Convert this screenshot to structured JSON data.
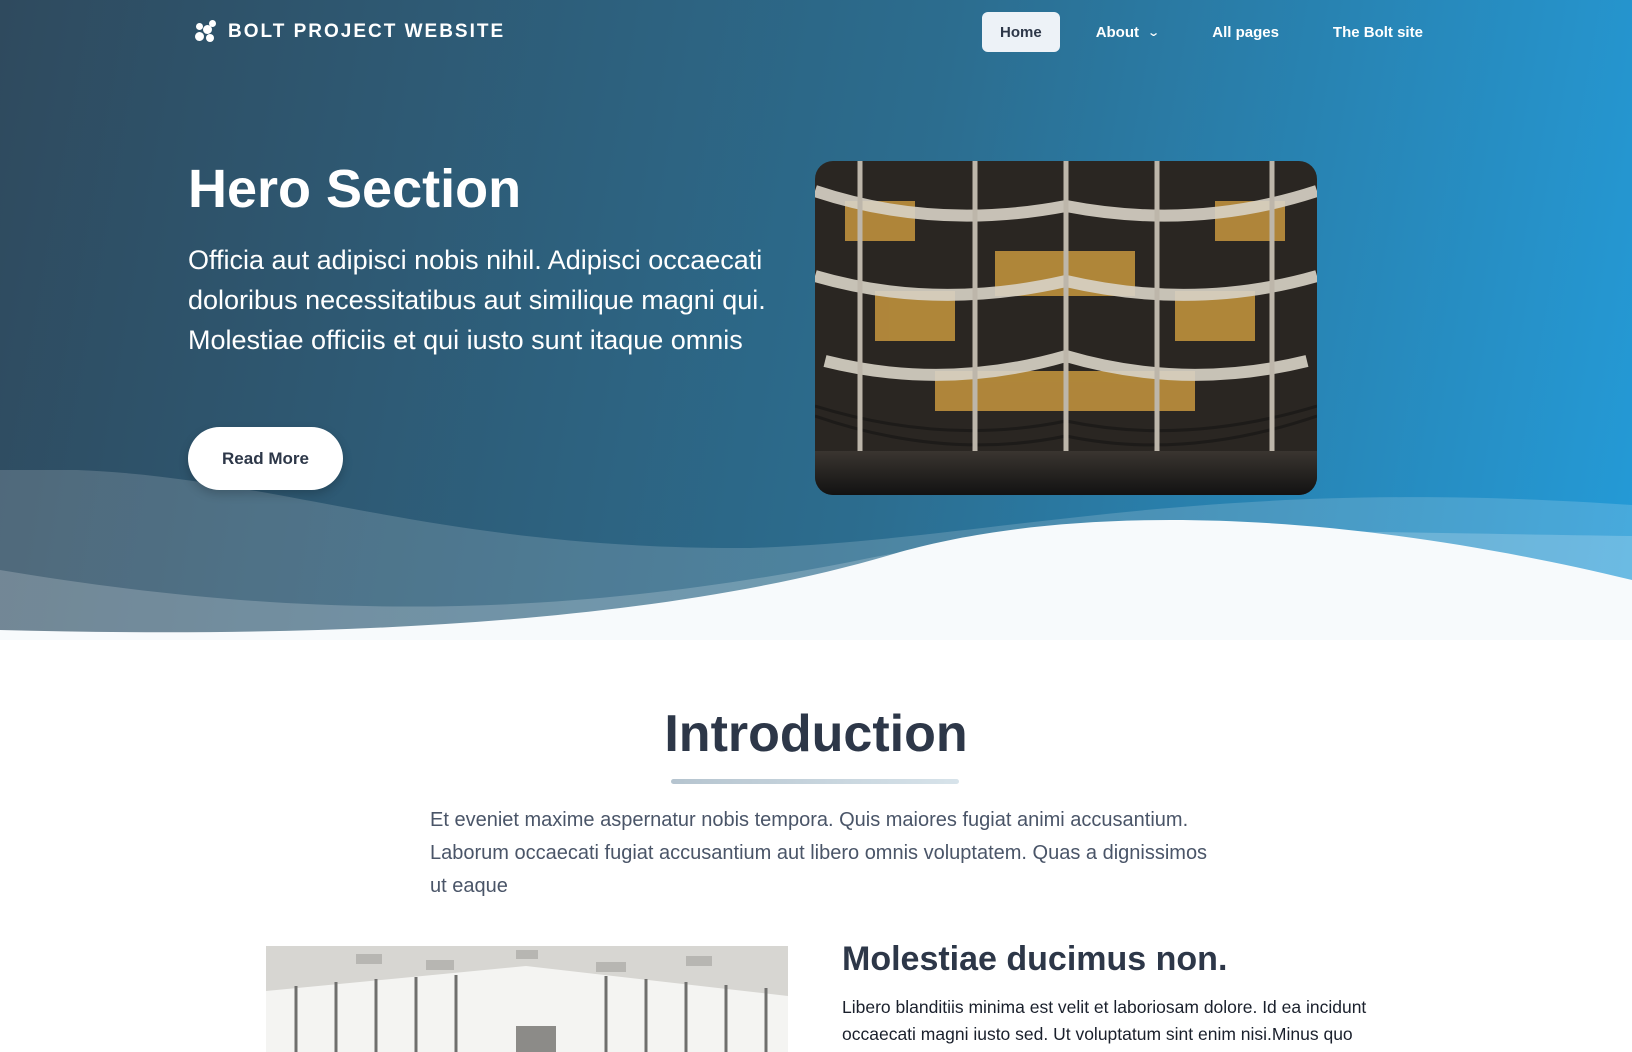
{
  "navbar": {
    "brand": "BOLT PROJECT WEBSITE",
    "items": [
      {
        "label": "Home",
        "active": true
      },
      {
        "label": "About",
        "dropdown": true
      },
      {
        "label": "All pages"
      },
      {
        "label": "The Bolt site"
      }
    ]
  },
  "hero": {
    "title": "Hero Section",
    "text": "Officia aut adipisci nobis nihil. Adipisci occaecati doloribus necessitatibus aut similique magni qui. Molestiae officiis et qui iusto sunt itaque omnis",
    "button": "Read More"
  },
  "intro": {
    "title": "Introduction",
    "text": "Et eveniet maxime aspernatur nobis tempora. Quis maiores fugiat animi accusantium. Laborum occaecati fugiat accusantium aut libero omnis voluptatem. Quas a dignissimos ut eaque"
  },
  "feature": {
    "title": "Molestiae ducimus non.",
    "text": "Libero blanditiis minima est velit et laboriosam dolore. Id ea incidunt occaecati magni iusto sed. Ut voluptatum sint enim nisi.Minus quo"
  },
  "icons": {
    "brand": "bolt-logo-icon",
    "about_dropdown": "chevron-down-icon"
  },
  "colors": {
    "hero_gradient_start": "#2f4a5e",
    "hero_gradient_end": "#249bd8",
    "text_dark": "#2d3748",
    "white": "#ffffff"
  }
}
